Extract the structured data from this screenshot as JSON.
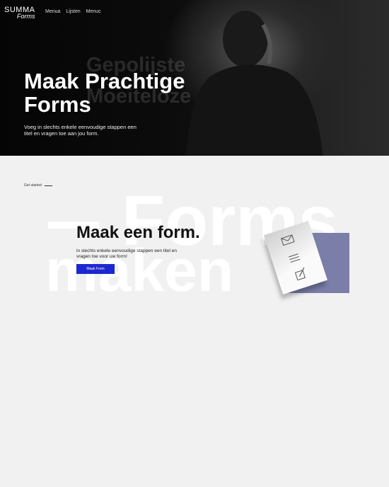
{
  "brand": {
    "line1": "SUMMA",
    "line2": "Forms",
    "accent": "#c0306a"
  },
  "nav": [
    "Menua",
    "Lijsten",
    "Menuc"
  ],
  "hero": {
    "ghost1": "Gepolijste",
    "ghost2": "Moeiteloze",
    "title_line1": "Maak Prachtige",
    "title_line2": "Forms",
    "subtitle": "Voeg in slechts enkele eenvoudige stappen een titel en vragen toe aan jou form."
  },
  "section": {
    "eyebrow": "Get started",
    "bg_word1": "Forms",
    "bg_word2": "maken",
    "title": "Maak een form.",
    "text": "in slechts enkele eenvoudige stappen een titel en vragen toe voor uw form!",
    "button": "Maak Form",
    "button_color": "#1d27d0"
  }
}
